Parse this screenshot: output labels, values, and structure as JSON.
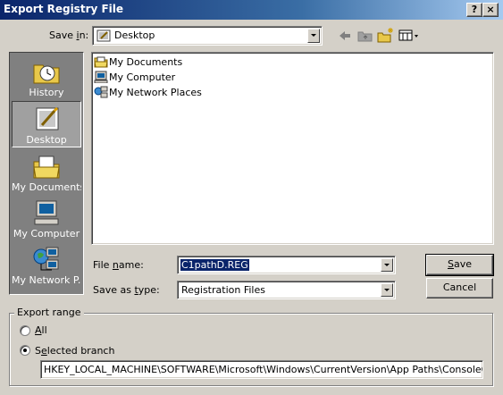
{
  "window": {
    "title": "Export Registry File",
    "help_button": "?",
    "close_button": "×"
  },
  "save_in": {
    "label_pre": "Save ",
    "label_mnemonic": "i",
    "label_post": "n:",
    "value": "Desktop"
  },
  "toolbar": {
    "back_icon": "back-arrow-icon",
    "up_icon": "up-folder-icon",
    "new_folder_icon": "new-folder-icon",
    "views_icon": "views-menu-icon"
  },
  "places": [
    {
      "label": "History",
      "icon": "history-icon"
    },
    {
      "label": "Desktop",
      "icon": "desktop-icon",
      "selected": true
    },
    {
      "label": "My Documents",
      "icon": "my-documents-icon"
    },
    {
      "label": "My Computer",
      "icon": "my-computer-icon"
    },
    {
      "label": "My Network P...",
      "icon": "my-network-places-icon"
    }
  ],
  "files": [
    {
      "name": "My Documents",
      "icon": "folder-icon"
    },
    {
      "name": "My Computer",
      "icon": "computer-icon"
    },
    {
      "name": "My Network Places",
      "icon": "network-icon"
    }
  ],
  "file_name": {
    "label_pre": "File ",
    "label_mnemonic": "n",
    "label_post": "ame:",
    "value": "C1pathD.REG"
  },
  "save_as_type": {
    "label_pre": "Save as ",
    "label_mnemonic": "t",
    "label_post": "ype:",
    "value": "Registration Files"
  },
  "buttons": {
    "save_mnemonic": "S",
    "save_rest": "ave",
    "cancel": "Cancel"
  },
  "export_range": {
    "legend": "Export range",
    "all_mnemonic": "A",
    "all_rest": "ll",
    "selected_mnemonic": "e",
    "selected_pre": "S",
    "selected_post": "lected branch",
    "branch_path": "HKEY_LOCAL_MACHINE\\SOFTWARE\\Microsoft\\Windows\\CurrentVersion\\App Paths\\ConsoleOne.e",
    "selected_option": "Selected branch"
  },
  "colors": {
    "title_active": "#0a246a",
    "face": "#d4d0c8",
    "places_bg": "#808080",
    "selection": "#0a246a"
  }
}
